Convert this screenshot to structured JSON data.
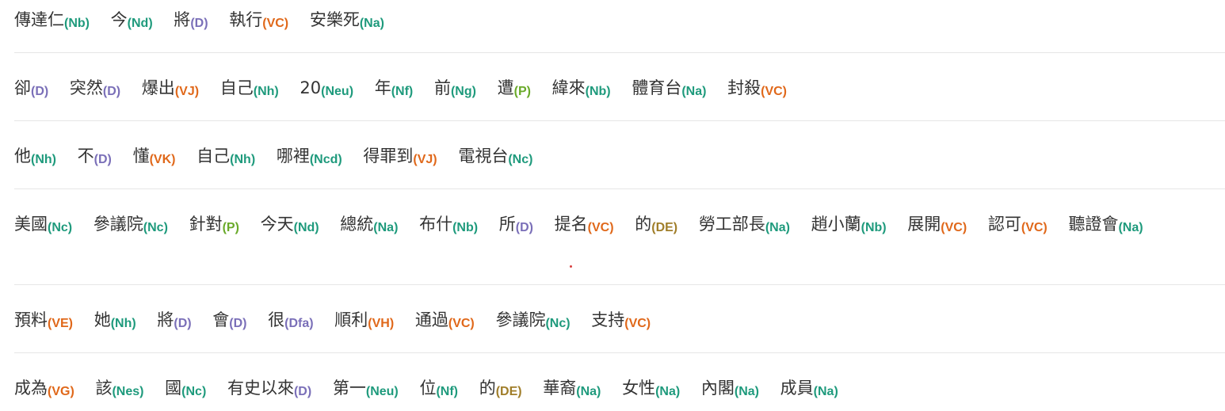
{
  "colors": {
    "Na": "#1e9a7c",
    "Nb": "#1e9a7c",
    "Nc": "#1e9a7c",
    "Nd": "#1e9a7c",
    "Nh": "#1e9a7c",
    "Neu": "#1e9a7c",
    "Nf": "#1e9a7c",
    "Ng": "#1e9a7c",
    "Ncd": "#1e9a7c",
    "Nes": "#1e9a7c",
    "D": "#7a6fb8",
    "Dfa": "#7a6fb8",
    "VC": "#e0681a",
    "VJ": "#e0681a",
    "VK": "#e0681a",
    "VE": "#e0681a",
    "VH": "#e0681a",
    "VG": "#e0681a",
    "P": "#6aaa2a",
    "DE": "#a07e2a"
  },
  "sentences": [
    [
      {
        "w": "傳達仁",
        "t": "(Nb)"
      },
      {
        "w": "今",
        "t": "(Nd)"
      },
      {
        "w": "將",
        "t": "(D)"
      },
      {
        "w": "執行",
        "t": "(VC)"
      },
      {
        "w": "安樂死",
        "t": "(Na)"
      }
    ],
    [
      {
        "w": "卻",
        "t": "(D)"
      },
      {
        "w": "突然",
        "t": "(D)"
      },
      {
        "w": "爆出",
        "t": "(VJ)"
      },
      {
        "w": "自己",
        "t": "(Nh)"
      },
      {
        "w": "20",
        "t": "(Neu)"
      },
      {
        "w": "年",
        "t": "(Nf)"
      },
      {
        "w": "前",
        "t": "(Ng)"
      },
      {
        "w": "遭",
        "t": "(P)"
      },
      {
        "w": "緯來",
        "t": "(Nb)"
      },
      {
        "w": "體育台",
        "t": "(Na)"
      },
      {
        "w": "封殺",
        "t": "(VC)"
      }
    ],
    [
      {
        "w": "他",
        "t": "(Nh)"
      },
      {
        "w": "不",
        "t": "(D)"
      },
      {
        "w": "懂",
        "t": "(VK)"
      },
      {
        "w": "自己",
        "t": "(Nh)"
      },
      {
        "w": "哪裡",
        "t": "(Ncd)"
      },
      {
        "w": "得罪到",
        "t": "(VJ)"
      },
      {
        "w": "電視台",
        "t": "(Nc)"
      }
    ],
    [
      {
        "w": "美國",
        "t": "(Nc)"
      },
      {
        "w": "參議院",
        "t": "(Nc)"
      },
      {
        "w": "針對",
        "t": "(P)"
      },
      {
        "w": "今天",
        "t": "(Nd)"
      },
      {
        "w": "總統",
        "t": "(Na)"
      },
      {
        "w": "布什",
        "t": "(Nb)"
      },
      {
        "w": "所",
        "t": "(D)"
      },
      {
        "w": "提名",
        "t": "(VC)"
      },
      {
        "w": "的",
        "t": "(DE)"
      },
      {
        "w": "勞工部長",
        "t": "(Na)"
      },
      {
        "w": "趙小蘭",
        "t": "(Nb)"
      },
      {
        "w": "展開",
        "t": "(VC)"
      },
      {
        "w": "認可",
        "t": "(VC)"
      },
      {
        "w": "聽證會",
        "t": "(Na)"
      }
    ],
    [
      {
        "w": "預料",
        "t": "(VE)"
      },
      {
        "w": "她",
        "t": "(Nh)"
      },
      {
        "w": "將",
        "t": "(D)"
      },
      {
        "w": "會",
        "t": "(D)"
      },
      {
        "w": "很",
        "t": "(Dfa)"
      },
      {
        "w": "順利",
        "t": "(VH)"
      },
      {
        "w": "通過",
        "t": "(VC)"
      },
      {
        "w": "參議院",
        "t": "(Nc)"
      },
      {
        "w": "支持",
        "t": "(VC)"
      }
    ],
    [
      {
        "w": "成為",
        "t": "(VG)"
      },
      {
        "w": "該",
        "t": "(Nes)"
      },
      {
        "w": "國",
        "t": "(Nc)"
      },
      {
        "w": "有史以來",
        "t": "(D)"
      },
      {
        "w": "第一",
        "t": "(Neu)"
      },
      {
        "w": "位",
        "t": "(Nf)"
      },
      {
        "w": "的",
        "t": "(DE)"
      },
      {
        "w": "華裔",
        "t": "(Na)"
      },
      {
        "w": "女性",
        "t": "(Na)"
      },
      {
        "w": "內閣",
        "t": "(Na)"
      },
      {
        "w": "成員",
        "t": "(Na)"
      }
    ]
  ]
}
